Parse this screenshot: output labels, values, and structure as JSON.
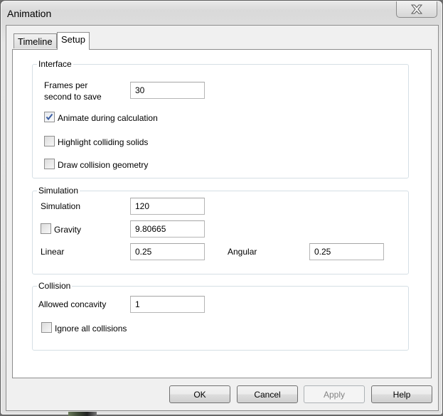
{
  "window": {
    "title": "Animation",
    "close_icon": "close-x-icon"
  },
  "tabs": [
    {
      "label": "Timeline",
      "active": false
    },
    {
      "label": "Setup",
      "active": true
    }
  ],
  "interface_group": {
    "title": "Interface",
    "fps_label": "Frames per second to save",
    "fps_label_line1": "Frames per",
    "fps_label_line2": "second to save",
    "fps_value": "30",
    "animate_during_calculation": {
      "label": "Animate during calculation",
      "checked": true
    },
    "highlight_colliding_solids": {
      "label": "Highlight colliding solids",
      "checked": false
    },
    "draw_collision_geometry": {
      "label": "Draw collision geometry",
      "checked": false
    }
  },
  "simulation_group": {
    "title": "Simulation",
    "simulation_label": "Simulation",
    "simulation_value": "120",
    "gravity": {
      "label": "Gravity",
      "checked": false,
      "value": "9.80665"
    },
    "linear_label": "Linear",
    "linear_value": "0.25",
    "angular_label": "Angular",
    "angular_value": "0.25"
  },
  "collision_group": {
    "title": "Collision",
    "allowed_concavity_label": "Allowed concavity",
    "allowed_concavity_value": "1",
    "ignore_all_collisions": {
      "label": "Ignore all collisions",
      "checked": false
    }
  },
  "buttons": {
    "ok": "OK",
    "cancel": "Cancel",
    "apply": "Apply",
    "help": "Help"
  }
}
